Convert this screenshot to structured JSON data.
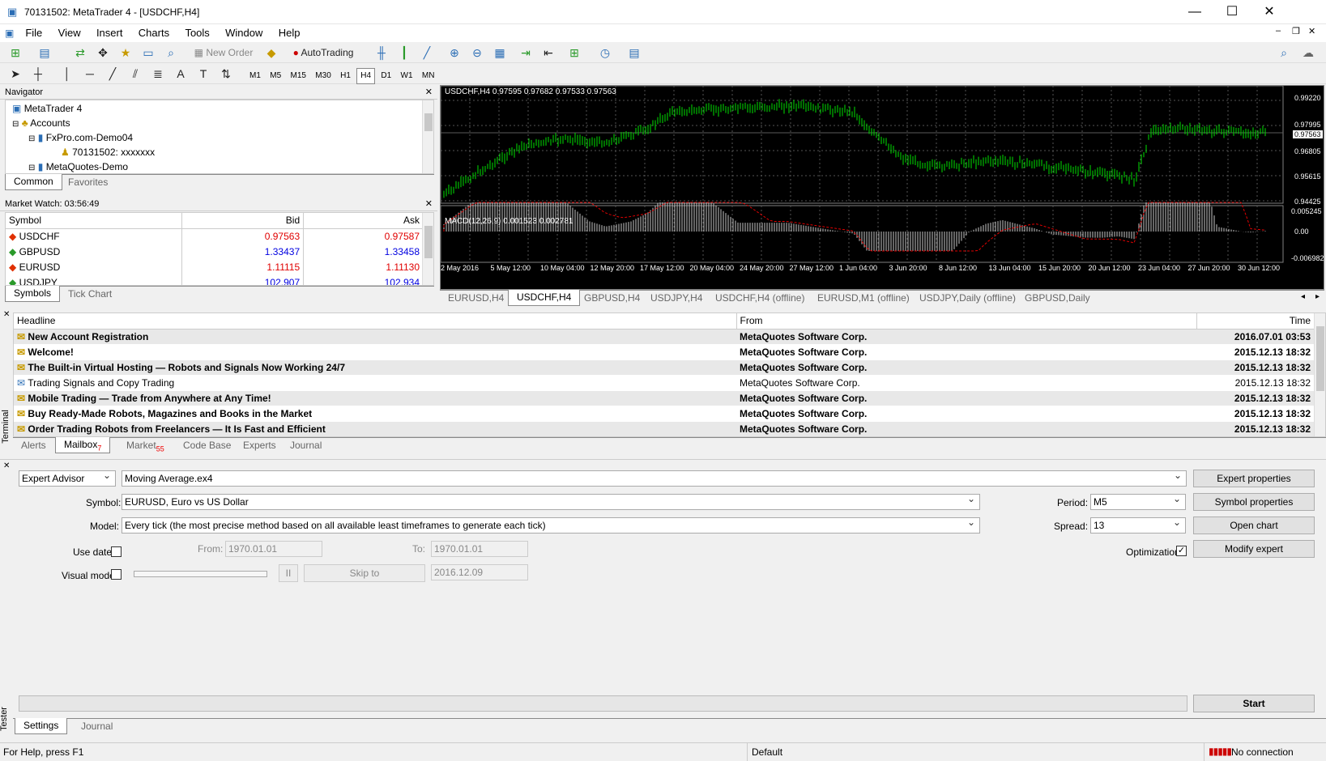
{
  "window": {
    "title": "70131502: MetaTrader 4 - [USDCHF,H4]"
  },
  "menu": [
    "File",
    "View",
    "Insert",
    "Charts",
    "Tools",
    "Window",
    "Help"
  ],
  "toolbar": {
    "new_order": "New Order",
    "autotrading": "AutoTrading"
  },
  "timeframes": [
    "M1",
    "M5",
    "M15",
    "M30",
    "H1",
    "H4",
    "D1",
    "W1",
    "MN"
  ],
  "navigator": {
    "title": "Navigator",
    "nodes": [
      "MetaTrader 4",
      "Accounts",
      "FxPro.com-Demo04",
      "70131502: xxxxxxx",
      "MetaQuotes-Demo"
    ],
    "tabs": [
      "Common",
      "Favorites"
    ]
  },
  "market_watch": {
    "title": "Market Watch: 03:56:49",
    "headers": [
      "Symbol",
      "Bid",
      "Ask"
    ],
    "rows": [
      {
        "symbol": "USDCHF",
        "bid": "0.97563",
        "ask": "0.97587",
        "color": "#e00000"
      },
      {
        "symbol": "GBPUSD",
        "bid": "1.33437",
        "ask": "1.33458",
        "color": "#0000e0"
      },
      {
        "symbol": "EURUSD",
        "bid": "1.11115",
        "ask": "1.11130",
        "color": "#e00000"
      },
      {
        "symbol": "USDJPY",
        "bid": "102.907",
        "ask": "102.934",
        "color": "#0000e0"
      }
    ],
    "tabs": [
      "Symbols",
      "Tick Chart"
    ]
  },
  "chart": {
    "title": "USDCHF,H4  0.97595 0.97682 0.97533 0.97563",
    "price_labels": [
      "0.99220",
      "0.97995",
      "0.97563",
      "0.96805",
      "0.95615",
      "0.94425"
    ],
    "macd_title": "MACD(12,26,9) 0.001523 0.002781",
    "macd_labels": [
      "0.005245",
      "0.00",
      "-0.006982"
    ],
    "date_labels": [
      "2 May 2016",
      "5 May 12:00",
      "10 May 04:00",
      "12 May 20:00",
      "17 May 12:00",
      "20 May 04:00",
      "24 May 20:00",
      "27 May 12:00",
      "1 Jun 04:00",
      "3 Jun 20:00",
      "8 Jun 12:00",
      "13 Jun 04:00",
      "15 Jun 20:00",
      "20 Jun 12:00",
      "23 Jun 04:00",
      "27 Jun 20:00",
      "30 Jun 12:00"
    ]
  },
  "chart_tabs": [
    "EURUSD,H4",
    "USDCHF,H4",
    "GBPUSD,H4",
    "USDJPY,H4",
    "USDCHF,H4 (offline)",
    "EURUSD,M1 (offline)",
    "USDJPY,Daily (offline)",
    "GBPUSD,Daily"
  ],
  "terminal": {
    "side_label": "Terminal",
    "headers": [
      "Headline",
      "From",
      "Time"
    ],
    "rows": [
      {
        "headline": "New Account Registration",
        "from": "MetaQuotes Software Corp.",
        "time": "2016.07.01 03:53",
        "bold": true
      },
      {
        "headline": "Welcome!",
        "from": "MetaQuotes Software Corp.",
        "time": "2015.12.13 18:32",
        "bold": true
      },
      {
        "headline": "The Built-in Virtual Hosting — Robots and Signals Now Working 24/7",
        "from": "MetaQuotes Software Corp.",
        "time": "2015.12.13 18:32",
        "bold": true
      },
      {
        "headline": "Trading Signals and Copy Trading",
        "from": "MetaQuotes Software Corp.",
        "time": "2015.12.13 18:32",
        "bold": false
      },
      {
        "headline": "Mobile Trading — Trade from Anywhere at Any Time!",
        "from": "MetaQuotes Software Corp.",
        "time": "2015.12.13 18:32",
        "bold": true
      },
      {
        "headline": "Buy Ready-Made Robots, Magazines and Books in the Market",
        "from": "MetaQuotes Software Corp.",
        "time": "2015.12.13 18:32",
        "bold": true
      },
      {
        "headline": "Order Trading Robots from Freelancers — It Is Fast and Efficient",
        "from": "MetaQuotes Software Corp.",
        "time": "2015.12.13 18:32",
        "bold": true
      }
    ],
    "tabs": [
      {
        "label": "Alerts",
        "badge": ""
      },
      {
        "label": "Mailbox",
        "badge": "7"
      },
      {
        "label": "Market",
        "badge": "55"
      },
      {
        "label": "Code Base",
        "badge": ""
      },
      {
        "label": "Experts",
        "badge": ""
      },
      {
        "label": "Journal",
        "badge": ""
      }
    ]
  },
  "tester": {
    "side_label": "Tester",
    "type": "Expert Advisor",
    "expert": "Moving Average.ex4",
    "symbol_label": "Symbol:",
    "symbol": "EURUSD, Euro vs US Dollar",
    "model_label": "Model:",
    "model": "Every tick (the most precise method based on all available least timeframes to generate each tick)",
    "use_date": "Use date",
    "from_label": "From:",
    "from": "1970.01.01",
    "to_label": "To:",
    "to": "1970.01.01",
    "visual_mode": "Visual mode",
    "pause": "II",
    "skip_to": "Skip to",
    "skip_date": "2016.12.09",
    "period_label": "Period:",
    "period": "M5",
    "spread_label": "Spread:",
    "spread": "13",
    "optimization": "Optimization",
    "buttons": [
      "Expert properties",
      "Symbol properties",
      "Open chart",
      "Modify expert"
    ],
    "start": "Start",
    "tabs": [
      "Settings",
      "Journal"
    ]
  },
  "status": {
    "help": "For Help, press F1",
    "profile": "Default",
    "connection": "No connection"
  }
}
